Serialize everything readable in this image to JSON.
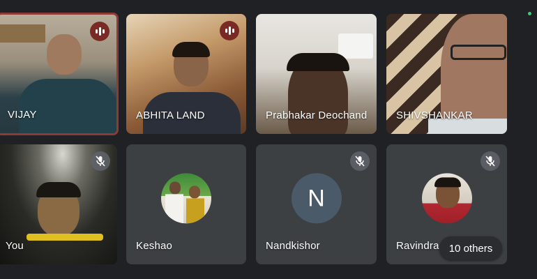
{
  "tiles": [
    {
      "name": "VIJAY"
    },
    {
      "name": "ABHITA LAND"
    },
    {
      "name": "Prabhakar Deochand"
    },
    {
      "name": "SHIVSHANKAR"
    },
    {
      "name": "You"
    },
    {
      "name": "Keshao"
    },
    {
      "name": "Nandkishor",
      "initial": "N"
    },
    {
      "name": "Ravindra"
    }
  ],
  "others_label": "10 others",
  "colors": {
    "background": "#202124",
    "tile": "#3c4043",
    "speaking_border": "#8e3b36",
    "avatar_initial_bg": "#4a5a68"
  },
  "icons": {
    "speaking": "audio-level-icon",
    "muted": "mic-off-icon"
  }
}
